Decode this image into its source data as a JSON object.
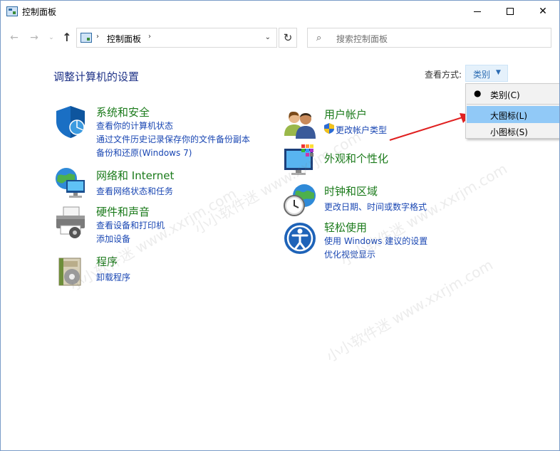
{
  "window": {
    "title": "控制面板"
  },
  "nav": {
    "back": "←",
    "forward": "→",
    "recent": "⌄",
    "up": "↑",
    "address_sep": "›",
    "address_text": "控制面板",
    "address_drop": "⌄",
    "refresh": "↻",
    "search_placeholder": "搜索控制面板"
  },
  "main": {
    "heading": "调整计算机的设置",
    "view_by_label": "查看方式:",
    "view_by_value": "类别"
  },
  "categories": [
    {
      "title": "系统和安全",
      "icon": "shield-icon",
      "links": [
        "查看你的计算机状态",
        "通过文件历史记录保存你的文件备份副本",
        "备份和还原(Windows 7)"
      ]
    },
    {
      "title": "网络和 Internet",
      "icon": "network-globe-icon",
      "links": [
        "查看网络状态和任务"
      ]
    },
    {
      "title": "硬件和声音",
      "icon": "printer-icon",
      "links": [
        "查看设备和打印机",
        "添加设备"
      ]
    },
    {
      "title": "程序",
      "icon": "programs-icon",
      "links": [
        "卸载程序"
      ]
    },
    {
      "title": "用户帐户",
      "icon": "users-icon",
      "links": [
        "更改帐户类型"
      ]
    },
    {
      "title": "外观和个性化",
      "icon": "monitor-palette-icon",
      "links": []
    },
    {
      "title": "时钟和区域",
      "icon": "clock-globe-icon",
      "links": [
        "更改日期、时间或数字格式"
      ]
    },
    {
      "title": "轻松使用",
      "icon": "ease-of-access-icon",
      "links": [
        "使用 Windows 建议的设置",
        "优化视觉显示"
      ]
    }
  ],
  "view_menu": {
    "items": [
      {
        "label": "类别(C)",
        "selected": true
      },
      {
        "label": "大图标(L)",
        "selected": false
      },
      {
        "label": "小图标(S)",
        "selected": false
      }
    ],
    "bullet": "●"
  },
  "watermark": {
    "text": "小小软件迷 www.xxrjm.com"
  },
  "colors": {
    "category_title": "#1a7a1a",
    "link": "#1a47b3",
    "heading": "#1e3287",
    "menu_highlight": "#91c9f7",
    "arrow": "#e02020"
  }
}
